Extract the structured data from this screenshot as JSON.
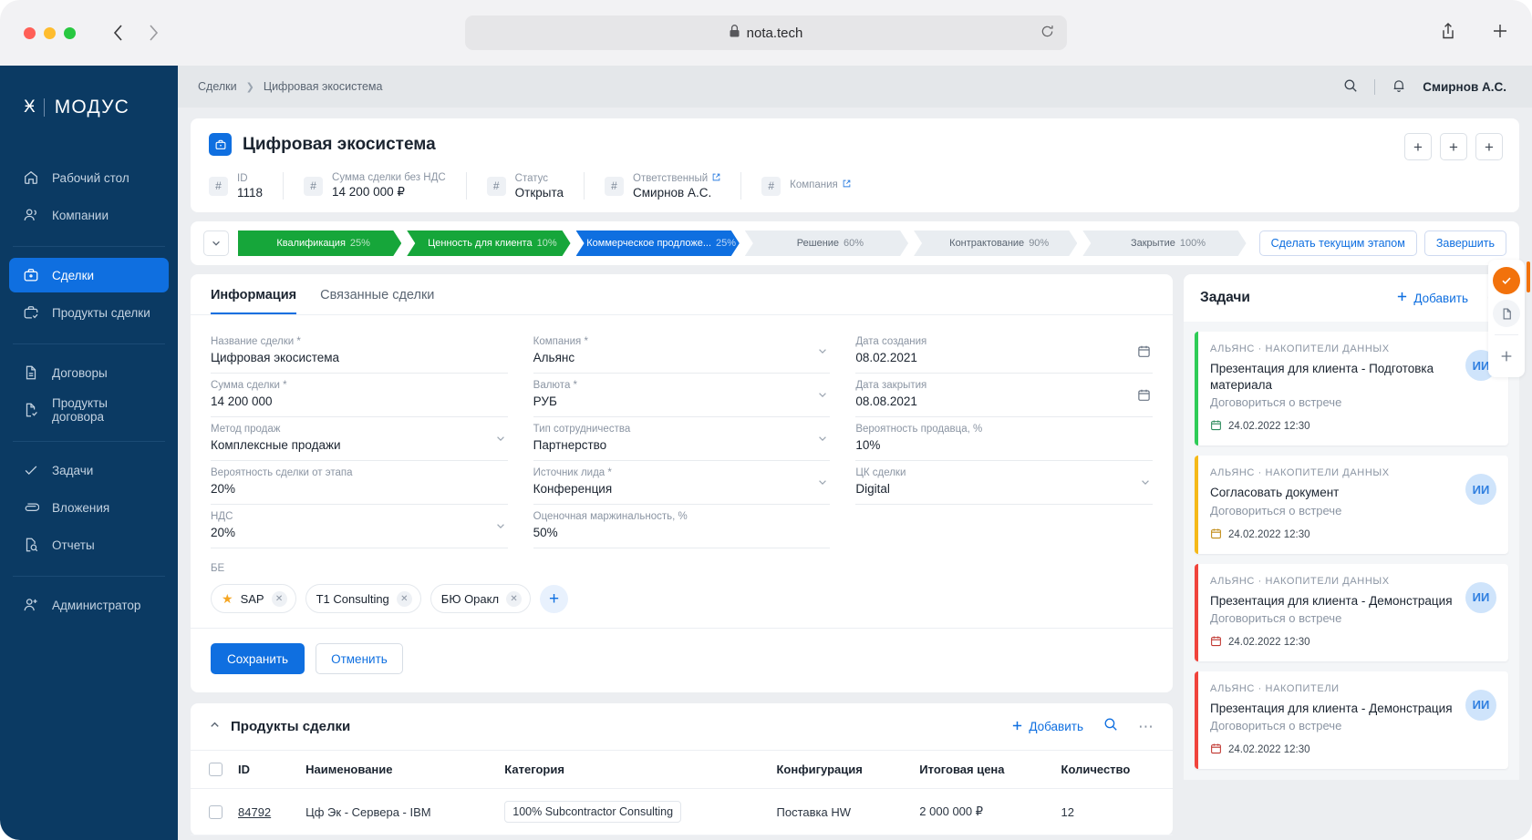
{
  "browser": {
    "url": "nota.tech",
    "lock_icon": "lock-icon",
    "reload_icon": "reload-icon",
    "back_icon": "back-arrow-icon",
    "forward_icon": "forward-arrow-icon",
    "share_icon": "share-icon",
    "newtab_icon": "plus-icon"
  },
  "sidebar": {
    "logo_mark": "Ӿ",
    "logo_word": "МОДУС",
    "groups": [
      {
        "items": [
          {
            "label": "Рабочий стол",
            "icon": "home-icon",
            "active": false
          },
          {
            "label": "Компании",
            "icon": "users-icon",
            "active": false
          }
        ]
      },
      {
        "items": [
          {
            "label": "Сделки",
            "icon": "briefcase-icon",
            "active": true
          },
          {
            "label": "Продукты сделки",
            "icon": "briefcase-check-icon",
            "active": false
          }
        ]
      },
      {
        "items": [
          {
            "label": "Договоры",
            "icon": "document-icon",
            "active": false
          },
          {
            "label": "Продукты договора",
            "icon": "document-check-icon",
            "active": false
          }
        ]
      },
      {
        "items": [
          {
            "label": "Задачи",
            "icon": "check-icon",
            "active": false
          },
          {
            "label": "Вложения",
            "icon": "paperclip-icon",
            "active": false
          },
          {
            "label": "Отчеты",
            "icon": "report-search-icon",
            "active": false
          }
        ]
      },
      {
        "items": [
          {
            "label": "Администратор",
            "icon": "user-plus-icon",
            "active": false
          }
        ]
      }
    ]
  },
  "topbar": {
    "breadcrumb": [
      "Сделки",
      "Цифровая экосистема"
    ],
    "search_icon": "search-icon",
    "bell_icon": "bell-icon",
    "user": "Смирнов А.С."
  },
  "deal": {
    "title": "Цифровая экосистема",
    "title_icon": "briefcase-icon",
    "header_buttons": [
      "+",
      "+",
      "+"
    ],
    "chips": [
      {
        "label": "ID",
        "value": "1118",
        "external": false
      },
      {
        "label": "Сумма сделки без НДС",
        "value": "14 200 000 ₽",
        "external": false
      },
      {
        "label": "Статус",
        "value": "Открыта",
        "external": false
      },
      {
        "label": "Ответственный",
        "value": "Смирнов А.С.",
        "external": true
      },
      {
        "label": "Компания",
        "value": "",
        "external": true
      }
    ]
  },
  "stages": {
    "toggle_icon": "chevron-down-icon",
    "items": [
      {
        "name": "Квалификация",
        "pct": "25%",
        "state": "done"
      },
      {
        "name": "Ценность для клиента",
        "pct": "10%",
        "state": "done"
      },
      {
        "name": "Коммерческое продложе...",
        "pct": "25%",
        "state": "current"
      },
      {
        "name": "Решение",
        "pct": "60%",
        "state": "todo"
      },
      {
        "name": "Контрактование",
        "pct": "90%",
        "state": "todo"
      },
      {
        "name": "Закрытие",
        "pct": "100%",
        "state": "todo"
      }
    ],
    "set_current_label": "Сделать текущим этапом",
    "finish_label": "Завершить"
  },
  "tabs": [
    {
      "label": "Информация",
      "active": true
    },
    {
      "label": "Связанные сделки",
      "active": false
    }
  ],
  "form": {
    "fields": [
      {
        "label": "Название сделки *",
        "value": "Цифровая экосистема",
        "control": "text"
      },
      {
        "label": "Компания *",
        "value": "Альянс",
        "control": "select"
      },
      {
        "label": "Дата создания",
        "value": "08.02.2021",
        "control": "date"
      },
      {
        "label": "Сумма сделки *",
        "value": "14 200 000",
        "control": "text"
      },
      {
        "label": "Валюта *",
        "value": "РУБ",
        "control": "select"
      },
      {
        "label": "Дата закрытия",
        "value": "08.08.2021",
        "control": "date"
      },
      {
        "label": "Метод продаж",
        "value": "Комплексные продажи",
        "control": "select"
      },
      {
        "label": "Тип сотрудничества",
        "value": "Партнерство",
        "control": "select"
      },
      {
        "label": "Вероятность продавца, %",
        "value": "10%",
        "control": "text"
      },
      {
        "label": "Вероятность сделки от этапа",
        "value": "20%",
        "control": "text"
      },
      {
        "label": "Источник лида *",
        "value": "Конференция",
        "control": "select"
      },
      {
        "label": "ЦК сделки",
        "value": "Digital",
        "control": "select"
      },
      {
        "label": "НДС",
        "value": "20%",
        "control": "select"
      },
      {
        "label": "Оценочная маржинальность, %",
        "value": "50%",
        "control": "text"
      },
      {
        "label": "",
        "value": "",
        "control": "blank"
      }
    ],
    "be_label": "БЕ",
    "be_tags": [
      {
        "name": "SAP",
        "starred": true
      },
      {
        "name": "T1 Consulting",
        "starred": false
      },
      {
        "name": "БЮ Оракл",
        "starred": false
      }
    ],
    "add_tag_icon": "plus-icon",
    "save_label": "Сохранить",
    "cancel_label": "Отменить"
  },
  "products": {
    "title": "Продукты сделки",
    "collapse_icon": "chevron-up-icon",
    "add_label": "Добавить",
    "search_icon": "search-icon",
    "more_icon": "more-horizontal-icon",
    "columns": [
      "ID",
      "Наименование",
      "Категория",
      "Конфигурация",
      "Итоговая цена",
      "Количество"
    ],
    "rows": [
      {
        "id": "84792",
        "name": "Цф Эк - Сервера - IBM",
        "category": "100% Subcontractor Consulting",
        "config": "Поставка HW",
        "price": "2 000 000 ₽",
        "qty": "12"
      }
    ]
  },
  "tasks": {
    "title": "Задачи",
    "add_label": "Добавить",
    "add_icon": "plus-icon",
    "more_icon": "more-horizontal-icon",
    "items": [
      {
        "org": "АЛЬЯНС  ·  НАКОПИТЕЛИ ДАННЫХ",
        "name": "Презентация для клиента - Подготовка материала",
        "sub": "Договориться о встрече",
        "date": "24.02.2022 12:30",
        "avatar": "ИИ",
        "accent": "#2ecc57"
      },
      {
        "org": "АЛЬЯНС  ·  НАКОПИТЕЛИ ДАННЫХ",
        "name": "Согласовать документ",
        "sub": "Договориться о встрече",
        "date": "24.02.2022 12:30",
        "avatar": "ИИ",
        "accent": "#f5b919"
      },
      {
        "org": "АЛЬЯНС  ·  НАКОПИТЕЛИ ДАННЫХ",
        "name": "Презентация для клиента - Демонстрация",
        "sub": "Договориться о встрече",
        "date": "24.02.2022 12:30",
        "avatar": "ИИ",
        "accent": "#f0443c"
      },
      {
        "org": "АЛЬЯНС  ·  НАКОПИТЕЛИ",
        "name": "Презентация для клиента - Демонстрация",
        "sub": "Договориться о встрече",
        "date": "24.02.2022 12:30",
        "avatar": "ИИ",
        "accent": "#f0443c"
      }
    ]
  },
  "rail": {
    "buttons": [
      {
        "icon": "check-circle-icon",
        "style": "accent"
      },
      {
        "icon": "document-icon",
        "style": "soft"
      },
      {
        "icon": "plus-icon",
        "style": "plain"
      }
    ]
  },
  "colors": {
    "brand_blue": "#0f6fe0",
    "sidebar": "#0b3a63",
    "stage_done": "#16a63a",
    "accent_orange": "#f2720c"
  }
}
